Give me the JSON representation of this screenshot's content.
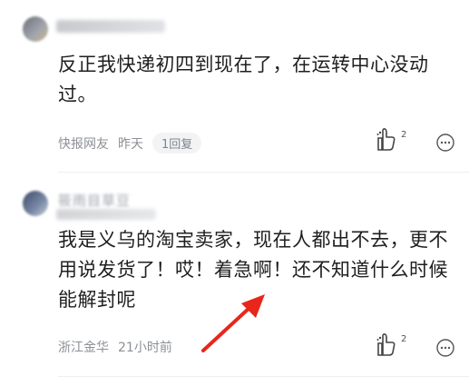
{
  "comments": [
    {
      "text": "反正我快递初四到现在了，在运转中心没动过。",
      "location": "快报网友",
      "time": "昨天",
      "reply_label": "1回复",
      "like_count": "2"
    },
    {
      "username": "筱雨目草豆",
      "text": "我是义乌的淘宝卖家，现在人都出不去，更不用说发货了！哎！着急啊！还不知道什么时候能解封呢",
      "location": "浙江金华",
      "time": "21小时前",
      "like_count": "2"
    }
  ],
  "colors": {
    "arrow": "#e8261c",
    "text": "#1f1f1f",
    "meta": "#8c9096"
  }
}
